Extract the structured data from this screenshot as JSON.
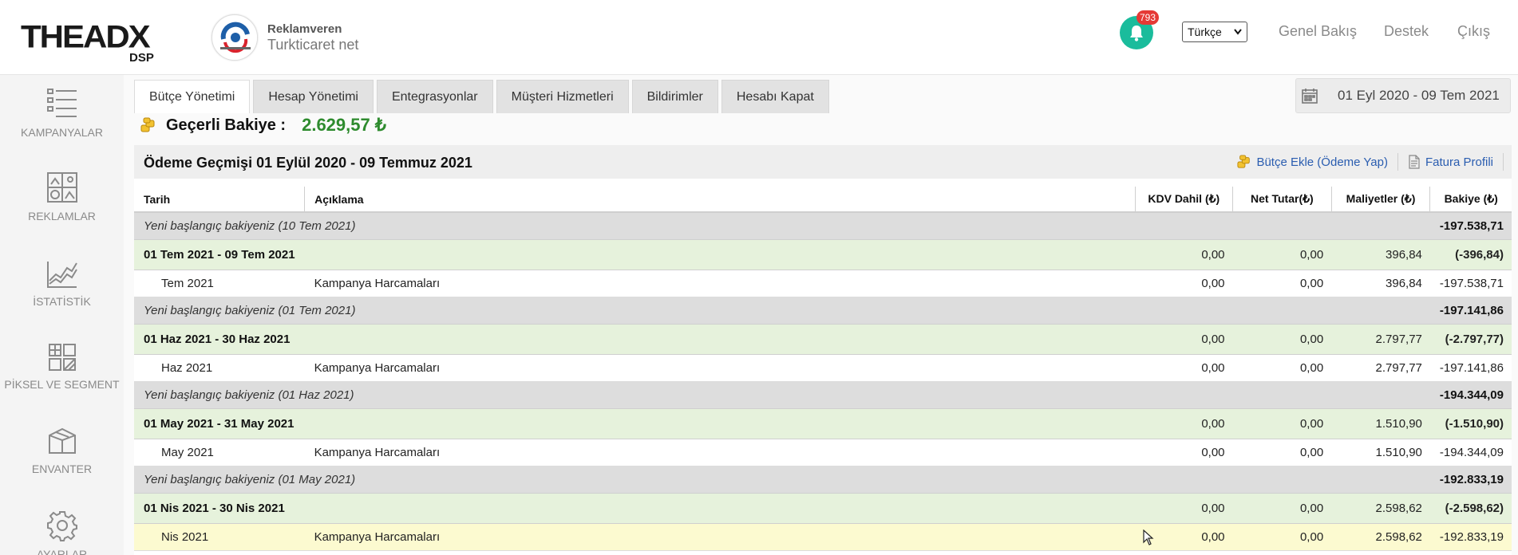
{
  "header": {
    "logo_main": "THEADX",
    "logo_sub": "DSP",
    "advertiser_role": "Reklamveren",
    "advertiser_name": "Turkticaret net",
    "notification_count": "793",
    "language": "Türkçe",
    "nav": [
      "Genel Bakış",
      "Destek",
      "Çıkış"
    ]
  },
  "sidebar": {
    "items": [
      {
        "label": "KAMPANYALAR",
        "icon": "campaigns-list-icon"
      },
      {
        "label": "REKLAMLAR",
        "icon": "ads-gallery-icon"
      },
      {
        "label": "İSTATİSTİK",
        "icon": "statistics-chart-icon"
      },
      {
        "label": "PİKSEL VE SEGMENT",
        "icon": "pixel-segment-icon"
      },
      {
        "label": "ENVANTER",
        "icon": "inventory-box-icon"
      },
      {
        "label": "AYARLAR",
        "icon": "gear-icon"
      }
    ]
  },
  "tabs": [
    "Bütçe Yönetimi",
    "Hesap Yönetimi",
    "Entegrasyonlar",
    "Müşteri Hizmetleri",
    "Bildirimler",
    "Hesabı Kapat"
  ],
  "date_range": "01 Eyl 2020 - 09 Tem 2021",
  "balance": {
    "label": "Geçerli Bakiye :",
    "value": "2.629,57 ₺"
  },
  "history": {
    "title": "Ödeme Geçmişi 01 Eylül 2020 - 09 Temmuz 2021",
    "add_budget": "Bütçe Ekle (Ödeme Yap)",
    "invoice_profile": "Fatura Profili"
  },
  "table": {
    "headers": [
      "Tarih",
      "Açıklama",
      "KDV Dahil (₺)",
      "Net Tutar(₺)",
      "Maliyetler (₺)",
      "Bakiye (₺)"
    ],
    "rows": [
      {
        "type": "start",
        "text": "Yeni başlangıç bakiyeniz (10 Tem 2021)",
        "balance": "-197.538,71"
      },
      {
        "type": "period",
        "date": "01 Tem 2021 - 09 Tem 2021",
        "kdv": "0,00",
        "net": "0,00",
        "cost": "396,84",
        "balance": "(-396,84)"
      },
      {
        "type": "detail",
        "date": "Tem 2021",
        "desc": "Kampanya Harcamaları",
        "kdv": "0,00",
        "net": "0,00",
        "cost": "396,84",
        "balance": "-197.538,71"
      },
      {
        "type": "start",
        "text": "Yeni başlangıç bakiyeniz (01 Tem 2021)",
        "balance": "-197.141,86"
      },
      {
        "type": "period",
        "date": "01 Haz 2021 - 30 Haz 2021",
        "kdv": "0,00",
        "net": "0,00",
        "cost": "2.797,77",
        "balance": "(-2.797,77)"
      },
      {
        "type": "detail",
        "date": "Haz 2021",
        "desc": "Kampanya Harcamaları",
        "kdv": "0,00",
        "net": "0,00",
        "cost": "2.797,77",
        "balance": "-197.141,86"
      },
      {
        "type": "start",
        "text": "Yeni başlangıç bakiyeniz (01 Haz 2021)",
        "balance": "-194.344,09"
      },
      {
        "type": "period",
        "date": "01 May 2021 - 31 May 2021",
        "kdv": "0,00",
        "net": "0,00",
        "cost": "1.510,90",
        "balance": "(-1.510,90)"
      },
      {
        "type": "detail",
        "date": "May 2021",
        "desc": "Kampanya Harcamaları",
        "kdv": "0,00",
        "net": "0,00",
        "cost": "1.510,90",
        "balance": "-194.344,09"
      },
      {
        "type": "start",
        "text": "Yeni başlangıç bakiyeniz (01 May 2021)",
        "balance": "-192.833,19"
      },
      {
        "type": "period",
        "date": "01 Nis 2021 - 30 Nis 2021",
        "kdv": "0,00",
        "net": "0,00",
        "cost": "2.598,62",
        "balance": "(-2.598,62)"
      },
      {
        "type": "detail",
        "date": "Nis 2021",
        "desc": "Kampanya Harcamaları",
        "kdv": "0,00",
        "net": "0,00",
        "cost": "2.598,62",
        "balance": "-192.833,19",
        "highlight": true
      }
    ]
  }
}
